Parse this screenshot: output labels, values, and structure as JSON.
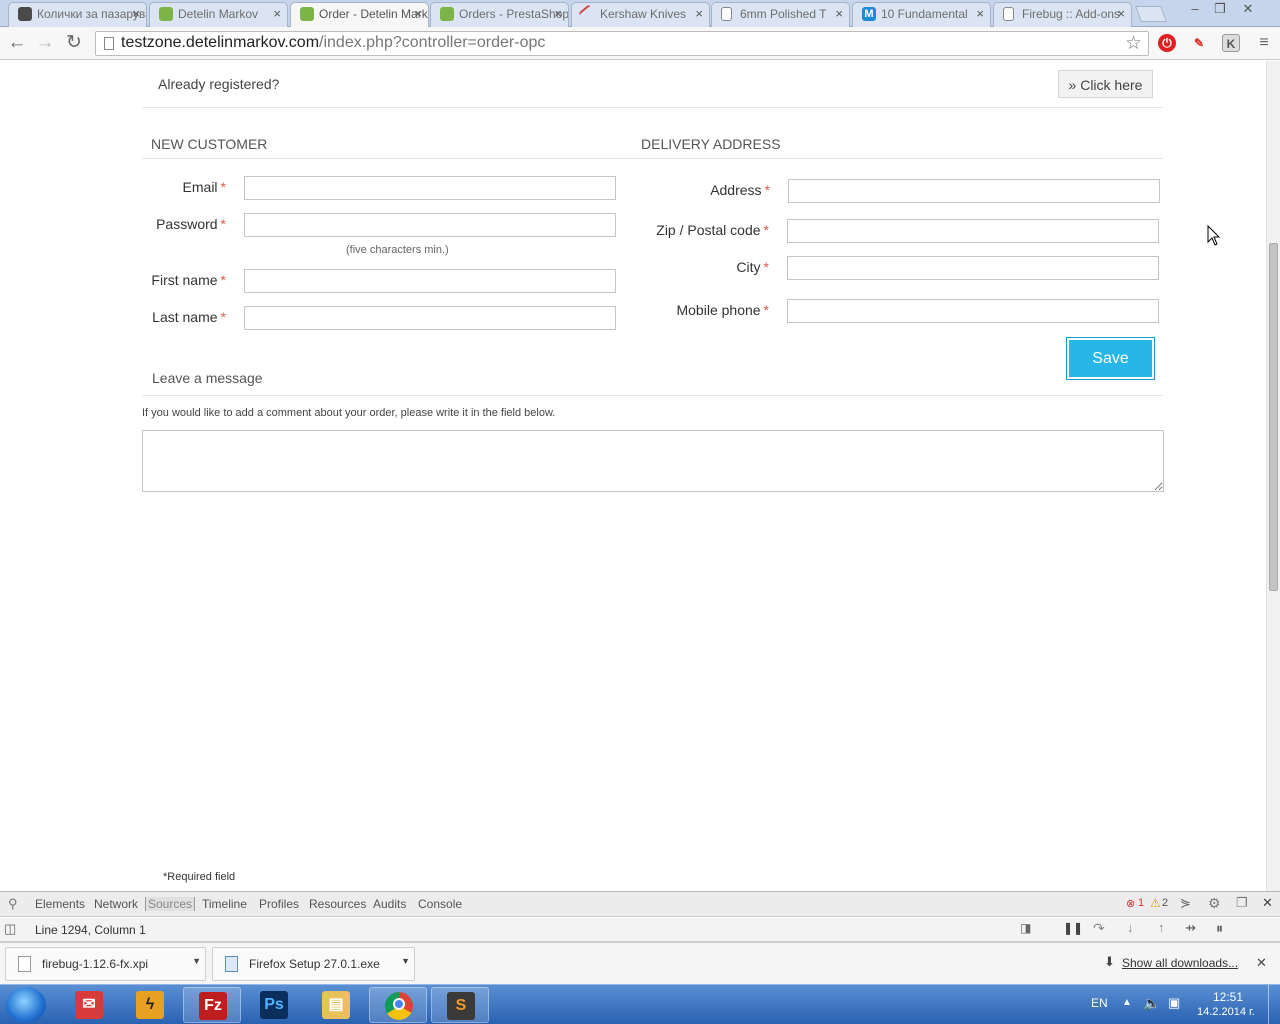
{
  "browser": {
    "tabs": [
      {
        "title": "Колички за пазаруване",
        "fav_color": "#4a4a4a"
      },
      {
        "title": "Detelin Markov",
        "fav_color": "#7bb547"
      },
      {
        "title": "Order - Detelin Markov",
        "fav_color": "#7bb547"
      },
      {
        "title": "Orders - PrestaShop",
        "fav_color": "#7bb547"
      },
      {
        "title": "Kershaw Knives",
        "fav_color": "#d83c3c"
      },
      {
        "title": "6mm Polished T",
        "fav_color": "#ffffff"
      },
      {
        "title": "10 Fundamental",
        "fav_color": "#1f8ad6"
      },
      {
        "title": "Firebug :: Add-ons",
        "fav_color": "#ffffff"
      }
    ],
    "tab_close": "×",
    "url_host": "testzone.detelinmarkov.com",
    "url_path": "/index.php?controller=order-opc",
    "window_controls": [
      "–",
      "❐",
      "✕"
    ]
  },
  "page": {
    "already_registered": "Already registered?",
    "click_here": "» Click here",
    "new_customer_title": "NEW CUSTOMER",
    "delivery_title": "DELIVERY ADDRESS",
    "required_mark": "*",
    "fields_left": [
      {
        "label": "Email",
        "value": ""
      },
      {
        "label": "Password",
        "value": ""
      },
      {
        "label": "First name",
        "value": ""
      },
      {
        "label": "Last name",
        "value": ""
      }
    ],
    "password_hint": "(five characters min.)",
    "fields_right": [
      {
        "label": "Address",
        "value": ""
      },
      {
        "label": "Zip / Postal code",
        "value": ""
      },
      {
        "label": "City",
        "value": ""
      },
      {
        "label": "Mobile phone",
        "value": ""
      }
    ],
    "save_label": "Save",
    "leave_message_title": "Leave a message",
    "message_desc": "If you would like to add a comment about your order, please write it in the field below.",
    "required_field": "*Required field"
  },
  "devtools": {
    "tabs": [
      "Elements",
      "Network",
      "Sources",
      "Timeline",
      "Profiles",
      "Resources",
      "Audits",
      "Console"
    ],
    "active_tab": "Sources",
    "errors": "1",
    "warnings": "2",
    "status": "Line 1294, Column 1"
  },
  "downloads": {
    "items": [
      "firebug-1.12.6-fx.xpi",
      "Firefox Setup 27.0.1.exe"
    ],
    "show_all": "Show all downloads...",
    "close": "✕"
  },
  "taskbar": {
    "lang": "EN",
    "time": "12:51",
    "date": "14.2.2014 г."
  },
  "colors": {
    "accent": "#26b6e8",
    "required": "#e05a4a"
  }
}
